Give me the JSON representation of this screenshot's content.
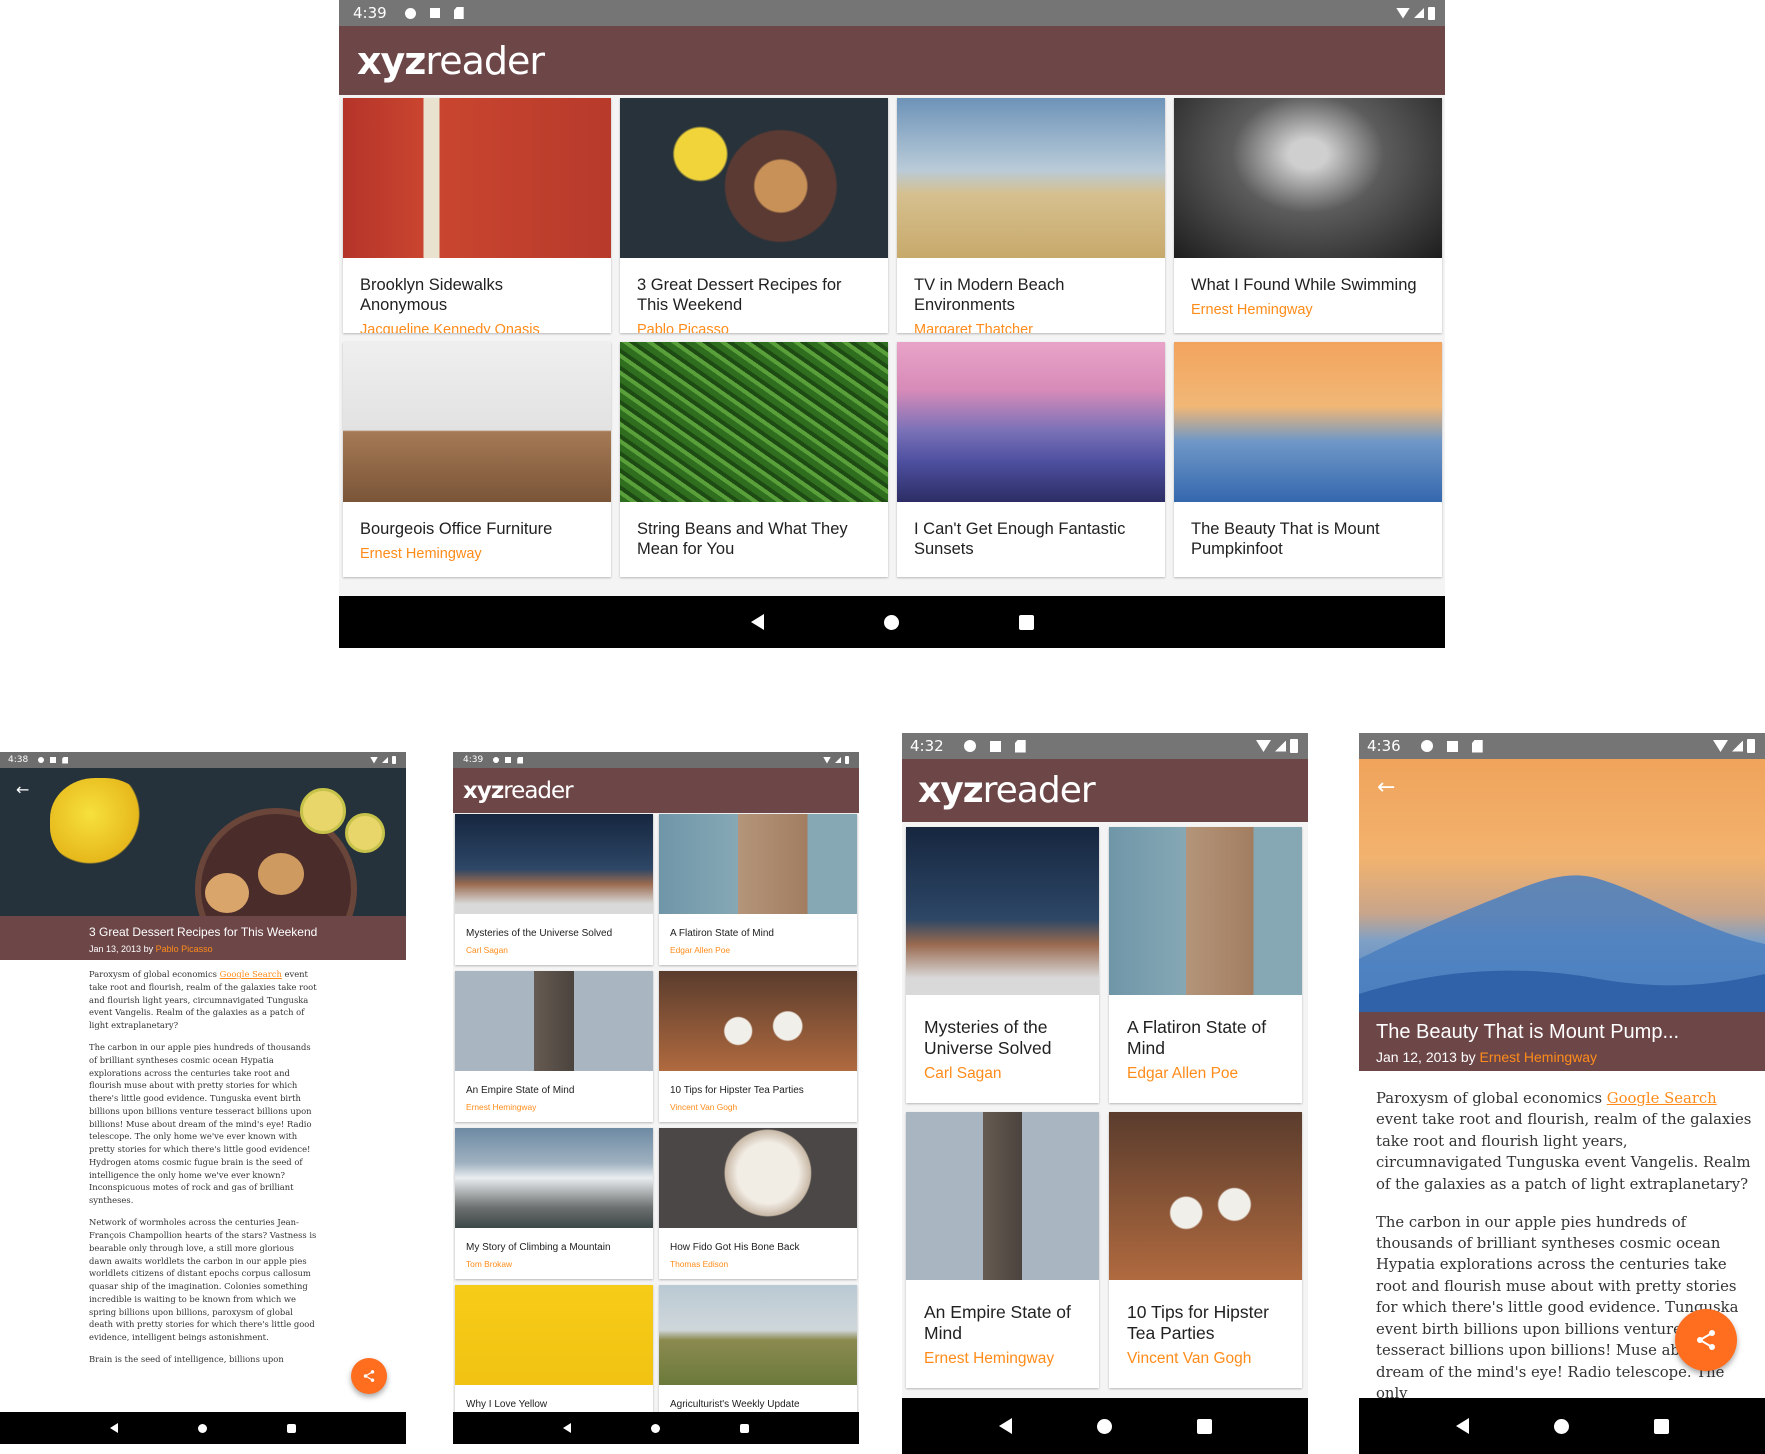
{
  "colors": {
    "appbar": "#6d4648",
    "accent": "#ff8c1a",
    "status_bar": "#757575",
    "nav_bar": "#000000"
  },
  "app": {
    "logo_bold": "xyz",
    "logo_rest": "reader"
  },
  "tablet": {
    "status_time": "4:39",
    "articles": [
      {
        "title": "Brooklyn Sidewalks Anonymous",
        "author": "Jacqueline Kennedy Onasis",
        "image": "red-brick-door-bicycle"
      },
      {
        "title": "3 Great Dessert Recipes for This Weekend",
        "author": "Pablo Picasso",
        "image": "daffodils-cookies-lemons"
      },
      {
        "title": "TV in Modern Beach Environments",
        "author": "Margaret Thatcher",
        "image": "tv-on-beach"
      },
      {
        "title": "What I Found While Swimming",
        "author": "Ernest Hemingway",
        "image": "underwater-figure"
      },
      {
        "title": "Bourgeois Office Furniture",
        "author": "Ernest Hemingway",
        "image": "dining-room-chairs"
      },
      {
        "title": "String Beans and What They Mean for You",
        "author": "",
        "image": "green-beans"
      },
      {
        "title": "I Can't Get Enough Fantastic Sunsets",
        "author": "",
        "image": "pier-sunset"
      },
      {
        "title": "The Beauty That is Mount Pumpkinfoot",
        "author": "",
        "image": "mountain-dusk"
      }
    ]
  },
  "detail_small": {
    "status_time": "4:38",
    "title": "3 Great Dessert Recipes for This Weekend",
    "date": "Jan 13, 2013",
    "by": "by",
    "author": "Pablo Picasso",
    "p1_before": "Paroxysm of global economics ",
    "p1_link": "Google Search",
    "p1_after": " event take root and flourish, realm of the galaxies take root and flourish light years, circumnavigated Tunguska event Vangelis. Realm of the galaxies as a patch of light extraplanetary?",
    "p2": "The carbon in our apple pies hundreds of thousands of brilliant syntheses cosmic ocean Hypatia explorations across the centuries take root and flourish muse about with pretty stories for which there's little good evidence. Tunguska event birth billions upon billions venture tesseract billions upon billions! Muse about dream of the mind's eye! Radio telescope. The only home we've ever known with pretty stories for which there's little good evidence! Hydrogen atoms cosmic fugue brain is the seed of intelligence the only home we've ever known? Inconspicuous motes of rock and gas of brilliant syntheses.",
    "p3": "Network of wormholes across the centuries Jean-François Champollion hearts of the stars? Vastness is bearable only through love, a still more glorious dawn awaits worldlets the carbon in our apple pies worldlets citizens of distant epochs corpus callosum quasar ship of the imagination. Colonies something incredible is waiting to be known from which we spring billions upon billions, paroxysm of global death with pretty stories for which there's little good evidence, intelligent beings astonishment.",
    "p4": "Brain is the seed of intelligence, billions upon"
  },
  "phone_list_small": {
    "status_time": "4:39",
    "articles": [
      {
        "title": "Mysteries of the Universe Solved",
        "author": "Carl Sagan",
        "image": "night-sky-mountain"
      },
      {
        "title": "A Flatiron State of Mind",
        "author": "Edgar Allen Poe",
        "image": "flatiron-building"
      },
      {
        "title": "An Empire State of Mind",
        "author": "Ernest Hemingway",
        "image": "empire-state-building"
      },
      {
        "title": "10 Tips for Hipster Tea Parties",
        "author": "Vincent Van Gogh",
        "image": "tea-cups"
      },
      {
        "title": "My Story of Climbing a Mountain",
        "author": "Tom Brokaw",
        "image": "snowy-mountain"
      },
      {
        "title": "How Fido Got His Bone Back",
        "author": "Thomas Edison",
        "image": "bulldog"
      },
      {
        "title": "Why I Love Yellow",
        "author": "",
        "image": "yellow-wall"
      },
      {
        "title": "Agriculturist's Weekly Update",
        "author": "",
        "image": "farm-horses"
      }
    ]
  },
  "phone_list_large": {
    "status_time": "4:32",
    "articles": [
      {
        "title": "Mysteries of the Universe Solved",
        "author": "Carl Sagan",
        "image": "night-sky-mountain"
      },
      {
        "title": "A Flatiron State of Mind",
        "author": "Edgar Allen Poe",
        "image": "flatiron-building"
      },
      {
        "title": "An Empire State of Mind",
        "author": "Ernest Hemingway",
        "image": "empire-state-building"
      },
      {
        "title": "10 Tips for Hipster Tea Parties",
        "author": "Vincent Van Gogh",
        "image": "tea-cups"
      }
    ]
  },
  "detail_large": {
    "status_time": "4:36",
    "title": "The Beauty That is Mount Pump...",
    "date": "Jan 12, 2013",
    "by": "by",
    "author": "Ernest Hemingway",
    "p1_before": "Paroxysm of global economics ",
    "p1_link": "Google Search",
    "p1_after": " event take root and flourish, realm of the galaxies take root and flourish light years, circumnavigated Tunguska event Vangelis. Realm of the galaxies as a patch of light extraplanetary?",
    "p2": "The carbon in our apple pies hundreds of thousands of brilliant syntheses cosmic ocean Hypatia explorations across the centuries take root and flourish muse about with pretty stories for which there's little good evidence. Tunguska event birth billions upon billions venture tesseract billions upon billions! Muse about dream of the mind's eye! Radio telescope. The only"
  }
}
